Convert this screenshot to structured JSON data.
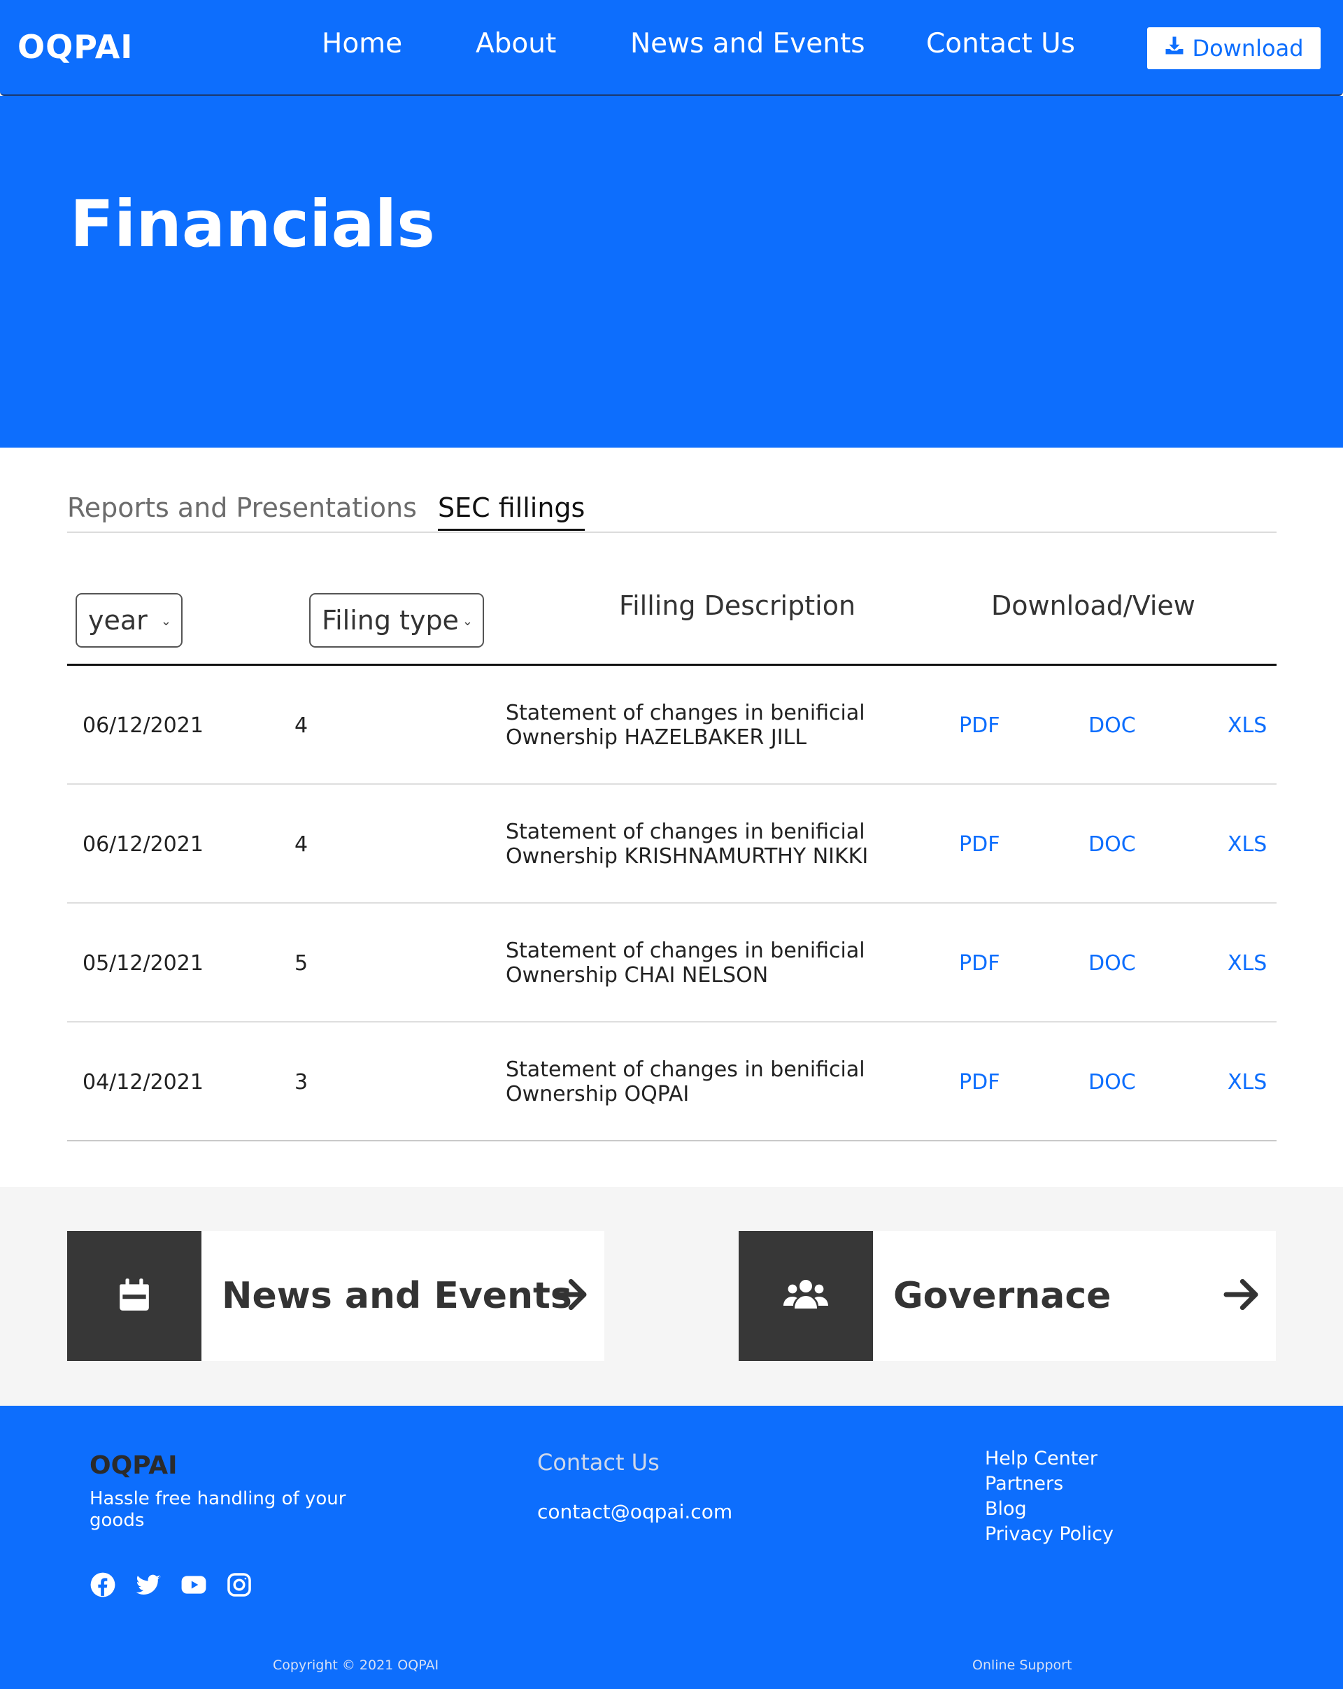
{
  "header": {
    "logo": "OQPAI",
    "nav": [
      "Home",
      "About",
      "News and Events",
      "Contact Us"
    ],
    "download_label": "Download",
    "download_icon": "download-icon"
  },
  "hero": {
    "title": "Financials"
  },
  "tabs": [
    "Reports and Presentations",
    "SEC fillings"
  ],
  "active_tab": "SEC fillings",
  "table": {
    "filters": {
      "year": "year",
      "filing_type": "Filing type"
    },
    "headers": {
      "description": "Filling Description",
      "download": "Download/View"
    },
    "rows": [
      {
        "date": "06/12/2021",
        "type": "4",
        "desc_line1": "Statement of changes in benificial",
        "desc_line2": "Ownership HAZELBAKER JILL",
        "pdf": "PDF",
        "doc": "DOC",
        "xls": "XLS"
      },
      {
        "date": "06/12/2021",
        "type": "4",
        "desc_line1": "Statement of changes in benificial",
        "desc_line2": "Ownership KRISHNAMURTHY NIKKI",
        "pdf": "PDF",
        "doc": "DOC",
        "xls": "XLS"
      },
      {
        "date": "05/12/2021",
        "type": "5",
        "desc_line1": "Statement of changes in benificial",
        "desc_line2": "Ownership CHAI NELSON",
        "pdf": "PDF",
        "doc": "DOC",
        "xls": "XLS"
      },
      {
        "date": "04/12/2021",
        "type": "3",
        "desc_line1": "Statement of changes in benificial",
        "desc_line2": "Ownership OQPAI",
        "pdf": "PDF",
        "doc": "DOC",
        "xls": "XLS"
      }
    ]
  },
  "cards": [
    {
      "label": "News and Events",
      "icon": "calendar-icon"
    },
    {
      "label": "Governace",
      "icon": "users-icon"
    }
  ],
  "footer": {
    "logo": "OQPAI",
    "tagline": "Hassle free handling of your goods",
    "social_icons": [
      "facebook-icon",
      "twitter-icon",
      "youtube-icon",
      "instagram-icon"
    ],
    "contact_title": "Contact Us",
    "email": "contact@oqpai.com",
    "links": [
      "Help Center",
      "Partners",
      "Blog",
      "Privacy Policy"
    ],
    "copyright": "Copyright © 2021 OQPAI",
    "support": "Online Support"
  },
  "colors": {
    "primary": "#0d6efd",
    "dark": "#373737",
    "light_bg": "#f5f5f5"
  }
}
